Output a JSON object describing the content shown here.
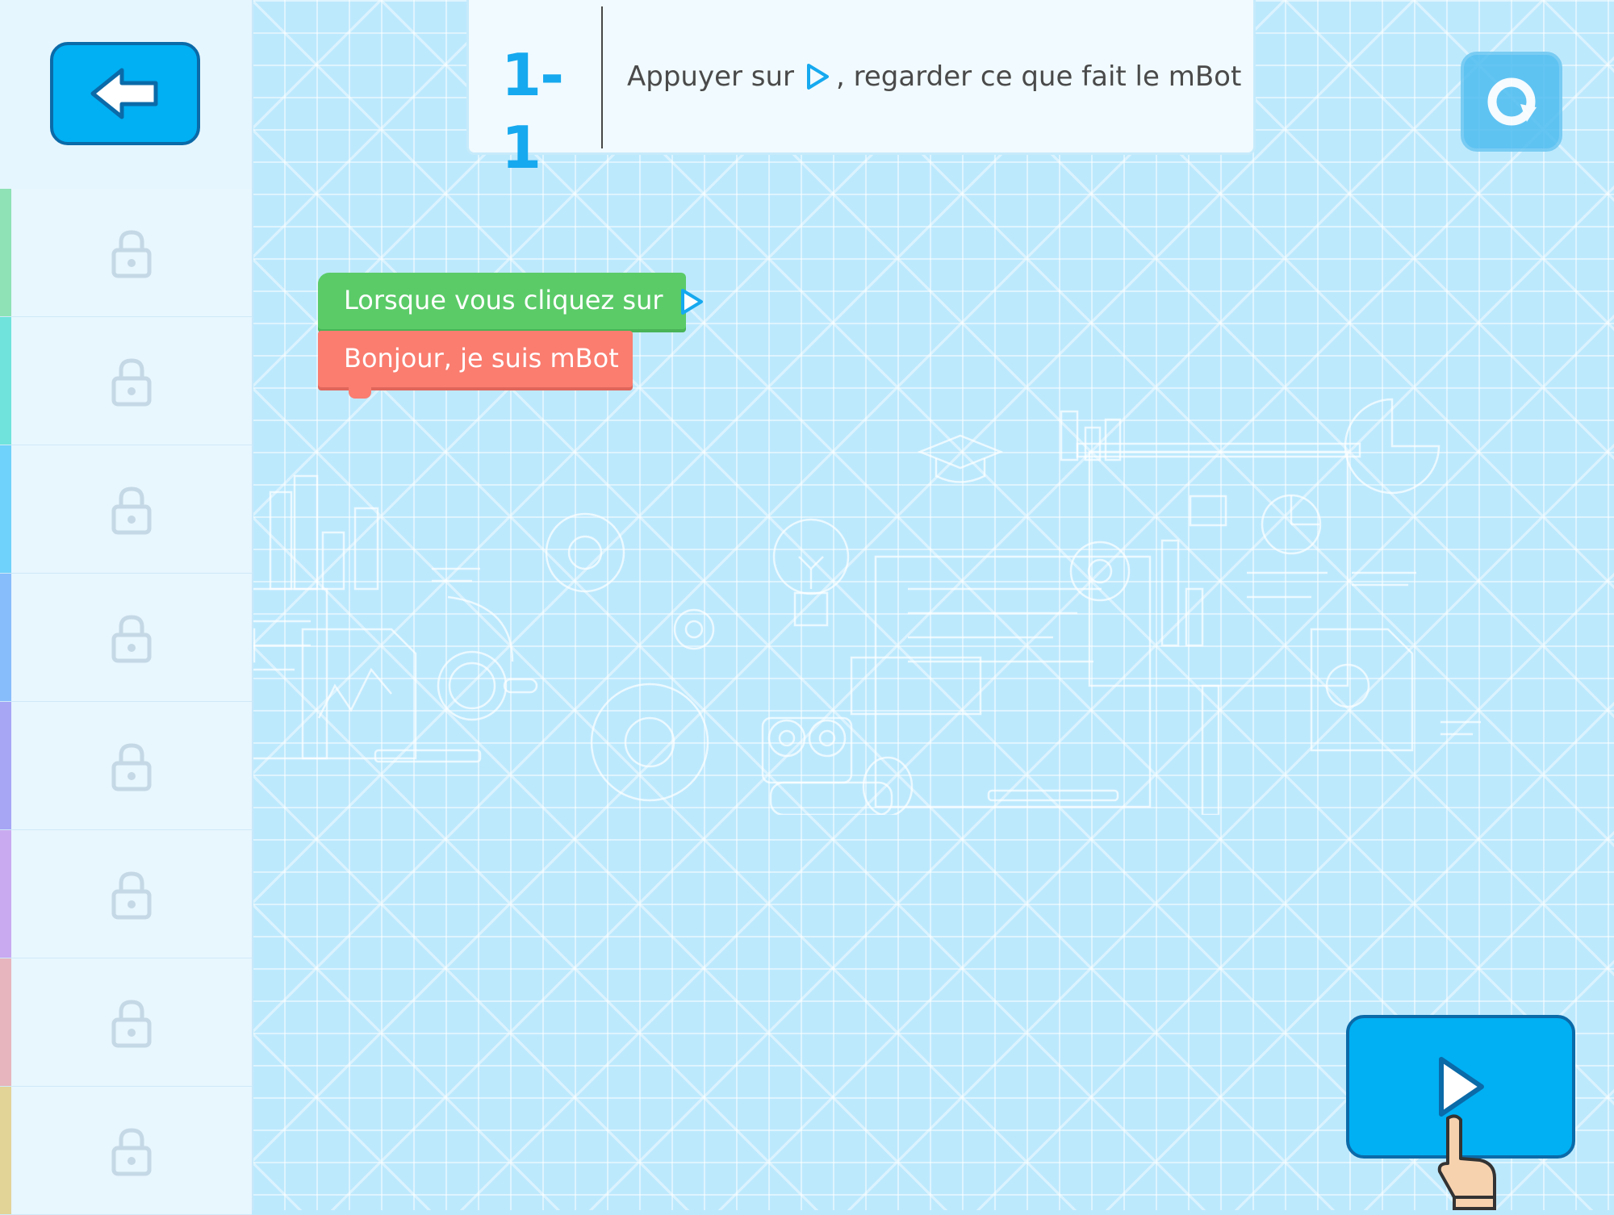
{
  "task": {
    "number": "1-1",
    "text_before": "Appuyer sur",
    "text_after": ", regarder ce que fait le mBot",
    "play_icon": "play-outline-icon"
  },
  "blocks": {
    "hat_label": "Lorsque vous cliquez sur",
    "say_label": "Bonjour, je suis mBot"
  },
  "sidebar": {
    "levels": [
      {
        "stripe_color": "#8ee2b5",
        "icon": "lock-icon",
        "locked": true
      },
      {
        "stripe_color": "#6fe3dc",
        "icon": "lock-icon",
        "locked": true
      },
      {
        "stripe_color": "#6fd2fa",
        "icon": "lock-icon",
        "locked": true
      },
      {
        "stripe_color": "#87bdfb",
        "icon": "lock-icon",
        "locked": true
      },
      {
        "stripe_color": "#a6a6f5",
        "icon": "lock-icon",
        "locked": true
      },
      {
        "stripe_color": "#c9aaf0",
        "icon": "lock-icon",
        "locked": true
      },
      {
        "stripe_color": "#e7b5bd",
        "icon": "lock-icon",
        "locked": true
      },
      {
        "stripe_color": "#e2d397",
        "icon": "lock-icon",
        "locked": true
      }
    ]
  },
  "buttons": {
    "back_icon": "arrow-left-icon",
    "reset_icon": "reset-icon",
    "run_icon": "play-icon",
    "hint_icon": "pointing-hand-icon"
  },
  "colors": {
    "primary": "#00b0f3",
    "hat_block": "#5bcb68",
    "say_block": "#fa7d70",
    "canvas": "#bde9fd"
  }
}
